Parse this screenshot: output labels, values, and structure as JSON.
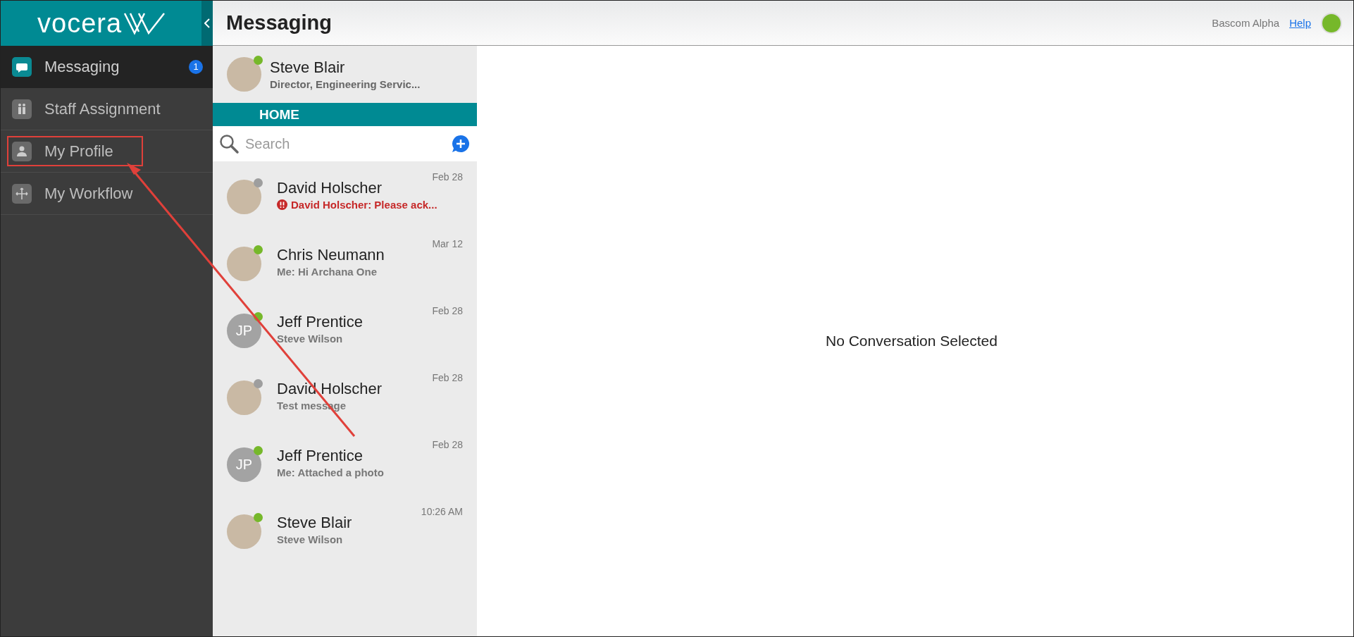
{
  "sidebar": {
    "logo": "vocera",
    "items": [
      {
        "kind": "chat",
        "label": "Messaging",
        "selected": true,
        "badge": "1",
        "highlighted": false
      },
      {
        "kind": "staff",
        "label": "Staff Assignment",
        "selected": false,
        "highlighted": false
      },
      {
        "kind": "person",
        "label": "My Profile",
        "selected": false,
        "highlighted": true
      },
      {
        "kind": "workflow",
        "label": "My Workflow",
        "selected": false,
        "highlighted": false
      }
    ]
  },
  "header": {
    "title": "Messaging",
    "user": "Bascom Alpha",
    "help_link": "Help",
    "online": true
  },
  "profile": {
    "name": "Steve Blair",
    "role": "Director, Engineering Servic...",
    "online": true
  },
  "home_tab": "HOME",
  "search": {
    "placeholder": "Search"
  },
  "conversations": [
    {
      "kind": "photo",
      "name": "David Holscher",
      "preview": "David Holscher: Please ack...",
      "date": "Feb 28",
      "online": false,
      "urgent": true
    },
    {
      "kind": "photo",
      "name": "Chris Neumann",
      "preview": "Me: Hi Archana One",
      "date": "Mar 12",
      "online": true,
      "urgent": false
    },
    {
      "kind": "initials",
      "initials": "JP",
      "name": "Jeff Prentice",
      "preview": "Steve Wilson",
      "date": "Feb 28",
      "online": true,
      "urgent": false
    },
    {
      "kind": "photo",
      "name": "David Holscher",
      "preview": "Test message",
      "date": "Feb 28",
      "online": false,
      "urgent": false
    },
    {
      "kind": "initials",
      "initials": "JP",
      "name": "Jeff Prentice",
      "preview": "Me: Attached a photo",
      "date": "Feb 28",
      "online": true,
      "urgent": false
    },
    {
      "kind": "photo",
      "name": "Steve Blair",
      "preview": "Steve Wilson",
      "date": "10:26 AM",
      "online": true,
      "urgent": false
    }
  ],
  "detail": {
    "empty_message": "No Conversation Selected"
  }
}
